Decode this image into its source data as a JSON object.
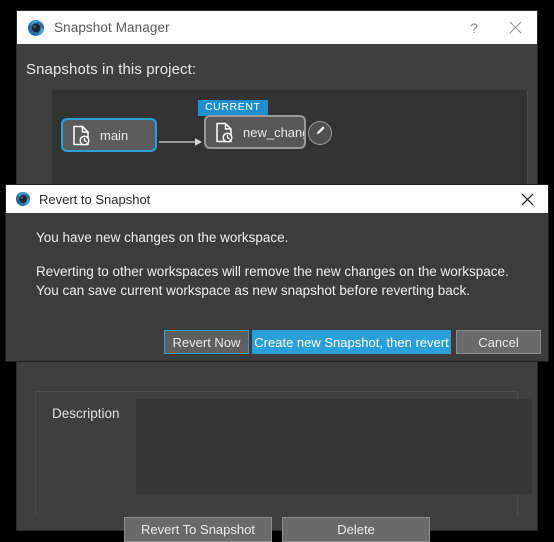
{
  "window": {
    "title": "Snapshot Manager",
    "icon": "app-logo-icon",
    "help_label": "?",
    "close_label": "✕"
  },
  "main": {
    "section_title": "Snapshots in this project:",
    "graph": {
      "nodes": [
        {
          "id": "main",
          "label": "main",
          "icon": "snapshot-document-clock-icon",
          "state": "selected"
        },
        {
          "id": "new_changes",
          "label": "new_changes",
          "icon": "snapshot-document-clock-icon",
          "state": "current",
          "badge": "CURRENT"
        }
      ],
      "edit_button_icon": "pencil-icon",
      "connector_icon": "arrow-right-icon"
    },
    "description": {
      "label": "Description",
      "value": "",
      "placeholder": ""
    },
    "buttons": {
      "revert_to_snapshot": "Revert To Snapshot",
      "delete": "Delete"
    }
  },
  "modal": {
    "title": "Revert to Snapshot",
    "icon": "app-logo-icon",
    "close_label": "✕",
    "line_1": "You have new changes on the workspace.",
    "line_2": "Reverting to other workspaces will remove the new changes on the workspace.",
    "line_3": "You can save current workspace as new snapshot before reverting back.",
    "buttons": {
      "revert_now": "Revert Now",
      "create_then_revert": "Create new Snapshot, then revert",
      "cancel": "Cancel"
    }
  },
  "colors": {
    "accent_blue": "#2a9fd8",
    "badge_blue": "#1f8fd0",
    "window_bg": "#3f3f3f",
    "panel_bg": "#333333",
    "modal_bg": "#3c3c3c",
    "titlebar_bg": "#ffffff",
    "text_light": "#eeeeee"
  }
}
